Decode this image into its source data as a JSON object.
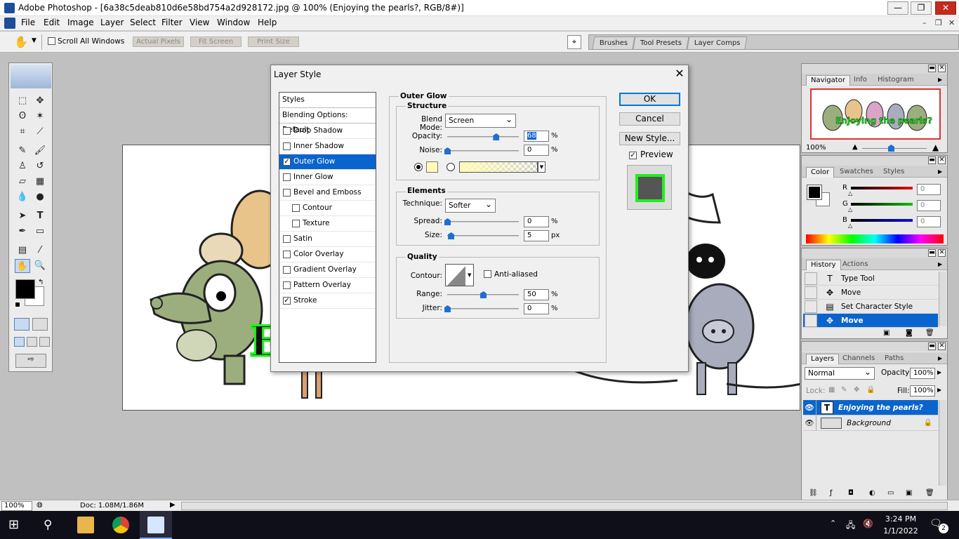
{
  "window": {
    "title": "Adobe Photoshop - [6a38c5deab810d6e58bd754a2d928172.jpg @ 100% (Enjoying the pearls?, RGB/8#)]",
    "minimize": "—",
    "maximize": "❐",
    "close": "✕"
  },
  "menu": {
    "items": [
      "File",
      "Edit",
      "Image",
      "Layer",
      "Select",
      "Filter",
      "View",
      "Window",
      "Help"
    ],
    "mdi_min": "–",
    "mdi_restore": "❐",
    "mdi_close": "✕"
  },
  "options_bar": {
    "scroll_all_windows": "Scroll All Windows",
    "actual_pixels": "Actual Pixels",
    "fit_screen": "Fit Screen",
    "print_size": "Print Size",
    "well_tabs": [
      "Brushes",
      "Tool Presets",
      "Layer Comps"
    ]
  },
  "canvas": {
    "text_fragment": "E"
  },
  "dialog": {
    "title": "Layer Style",
    "close": "✕",
    "styles_header": "Styles",
    "blending_options": "Blending Options: Default",
    "styles": [
      {
        "label": "Drop Shadow",
        "checked": false,
        "sub": false,
        "selected": false
      },
      {
        "label": "Inner Shadow",
        "checked": false,
        "sub": false,
        "selected": false
      },
      {
        "label": "Outer Glow",
        "checked": true,
        "sub": false,
        "selected": true
      },
      {
        "label": "Inner Glow",
        "checked": false,
        "sub": false,
        "selected": false
      },
      {
        "label": "Bevel and Emboss",
        "checked": false,
        "sub": false,
        "selected": false
      },
      {
        "label": "Contour",
        "checked": false,
        "sub": true,
        "selected": false
      },
      {
        "label": "Texture",
        "checked": false,
        "sub": true,
        "selected": false
      },
      {
        "label": "Satin",
        "checked": false,
        "sub": false,
        "selected": false
      },
      {
        "label": "Color Overlay",
        "checked": false,
        "sub": false,
        "selected": false
      },
      {
        "label": "Gradient Overlay",
        "checked": false,
        "sub": false,
        "selected": false
      },
      {
        "label": "Pattern Overlay",
        "checked": false,
        "sub": false,
        "selected": false
      },
      {
        "label": "Stroke",
        "checked": true,
        "sub": false,
        "selected": false
      }
    ],
    "outer_glow": {
      "title": "Outer Glow",
      "structure": {
        "title": "Structure",
        "blend_mode_label": "Blend Mode:",
        "blend_mode": "Screen",
        "opacity_label": "Opacity:",
        "opacity": "68",
        "opacity_level": 0.68,
        "noise_label": "Noise:",
        "noise": "0",
        "noise_level": 0,
        "percent": "%",
        "glow_color": "#fffbb8"
      },
      "elements": {
        "title": "Elements",
        "technique_label": "Technique:",
        "technique": "Softer",
        "spread_label": "Spread:",
        "spread": "0",
        "spread_level": 0,
        "size_label": "Size:",
        "size": "5",
        "size_level": 0.05,
        "px": "px",
        "percent": "%"
      },
      "quality": {
        "title": "Quality",
        "contour_label": "Contour:",
        "anti_aliased": "Anti-aliased",
        "range_label": "Range:",
        "range": "50",
        "range_level": 0.5,
        "jitter_label": "Jitter:",
        "jitter": "0",
        "jitter_level": 0,
        "percent": "%"
      }
    },
    "buttons": {
      "ok": "OK",
      "cancel": "Cancel",
      "new_style": "New Style...",
      "preview": "Preview"
    },
    "preview_colors": {
      "fill": "#555555",
      "glow": "#22ee22"
    }
  },
  "navigator": {
    "tabs": [
      "Navigator",
      "Info",
      "Histogram"
    ],
    "zoom": "100%",
    "thumb_text": "Enjoying the pearls?"
  },
  "color_panel": {
    "tabs": [
      "Color",
      "Swatches",
      "Styles"
    ],
    "channels": [
      {
        "label": "R",
        "value": "0",
        "color": "#e01010"
      },
      {
        "label": "G",
        "value": "0",
        "color": "#10c010"
      },
      {
        "label": "B",
        "value": "0",
        "color": "#1010e0"
      }
    ]
  },
  "history_panel": {
    "tabs": [
      "History",
      "Actions"
    ],
    "items": [
      {
        "icon": "T",
        "label": "Type Tool",
        "selected": false
      },
      {
        "icon": "✥",
        "label": "Move",
        "selected": false
      },
      {
        "icon": "▤",
        "label": "Set Character Style",
        "selected": false
      },
      {
        "icon": "✥",
        "label": "Move",
        "selected": true
      }
    ]
  },
  "layers_panel": {
    "tabs": [
      "Layers",
      "Channels",
      "Paths"
    ],
    "blend_mode": "Normal",
    "opacity_label": "Opacity:",
    "opacity": "100%",
    "lock_label": "Lock:",
    "fill_label": "Fill:",
    "fill": "100%",
    "layers": [
      {
        "name": "Enjoying the pearls?",
        "type": "text",
        "selected": true
      },
      {
        "name": "Background",
        "type": "image",
        "selected": false
      }
    ]
  },
  "status_bar": {
    "zoom": "100%",
    "doc": "Doc: 1.08M/1.86M"
  },
  "taskbar": {
    "time": "3:24 PM",
    "date": "1/1/2022",
    "notifications": "2"
  }
}
